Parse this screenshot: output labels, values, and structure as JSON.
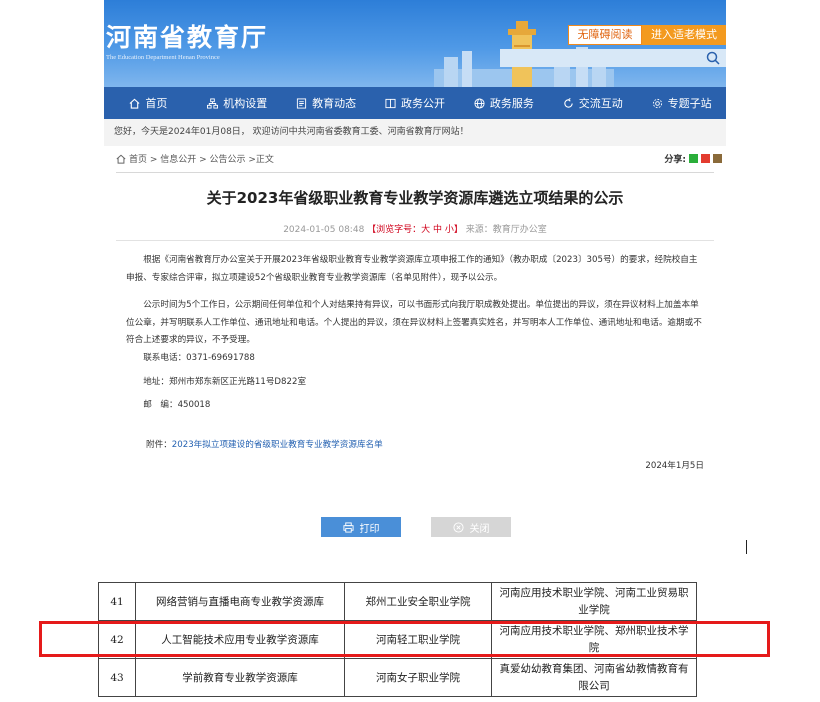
{
  "header": {
    "site_title": "河南省教育厅",
    "site_subtitle": "The Education Department Henan Province",
    "accessible_btn": "无障碍阅读",
    "elder_btn": "进入适老模式"
  },
  "nav": [
    {
      "label": "首页",
      "icon": "home-icon"
    },
    {
      "label": "机构设置",
      "icon": "org-icon"
    },
    {
      "label": "教育动态",
      "icon": "news-icon"
    },
    {
      "label": "政务公开",
      "icon": "document-icon"
    },
    {
      "label": "政务服务",
      "icon": "globe-icon"
    },
    {
      "label": "交流互动",
      "icon": "interact-icon"
    },
    {
      "label": "专题子站",
      "icon": "gear-icon"
    }
  ],
  "welcome": "您好，今天是2024年01月08日， 欢迎访问中共河南省委教育工委、河南省教育厅网站！",
  "breadcrumb": "首页 > 信息公开 > 公告公示 >正文",
  "share_label": "分享:",
  "article": {
    "title": "关于2023年省级职业教育专业教学资源库遴选立项结果的公示",
    "date": "2024-01-05 08:48",
    "font_size": "【浏览字号：大 中 小】",
    "source": "来源：教育厅办公室",
    "p1": "根据《河南省教育厅办公室关于开展2023年省级职业教育专业教学资源库立项申报工作的通知》（教办职成〔2023〕305号）的要求，经院校自主申报、专家综合评审，拟立项建设52个省级职业教育专业教学资源库（名单见附件），现予以公示。",
    "p2": "公示时间为5个工作日，公示期间任何单位和个人对结果持有异议，可以书面形式向我厅职成教处提出。单位提出的异议，须在异议材料上加盖本单位公章，并写明联系人工作单位、通讯地址和电话。个人提出的异议，须在异议材料上签署真实姓名，并写明本人工作单位、通讯地址和电话。逾期或不符合上述要求的异议，不予受理。",
    "phone": "联系电话：0371-69691788",
    "address": "地址：郑州市郑东新区正光路11号D822室",
    "postcode": "邮　编：450018",
    "attach_label": "附件：",
    "attach_link": "2023年拟立项建设的省级职业教育专业教学资源库名单",
    "sign_date": "2024年1月5日"
  },
  "buttons": {
    "print": "打印",
    "close": "关闭"
  },
  "table_rows": [
    {
      "no": "41",
      "name": "网络营销与直播电商专业教学资源库",
      "host": "郑州工业安全职业学院",
      "partners": "河南应用技术职业学院、河南工业贸易职业学院"
    },
    {
      "no": "42",
      "name": "人工智能技术应用专业教学资源库",
      "host": "河南轻工职业学院",
      "partners": "河南应用技术职业学院、郑州职业技术学院"
    },
    {
      "no": "43",
      "name": "学前教育专业教学资源库",
      "host": "河南女子职业学院",
      "partners": "真爱幼幼教育集团、河南省幼教情教育有限公司"
    }
  ],
  "colors": {
    "nav_bg": "#2a61ad",
    "accent_orange": "#f39a1f",
    "highlight": "#e51a1a",
    "link": "#2562b2"
  }
}
